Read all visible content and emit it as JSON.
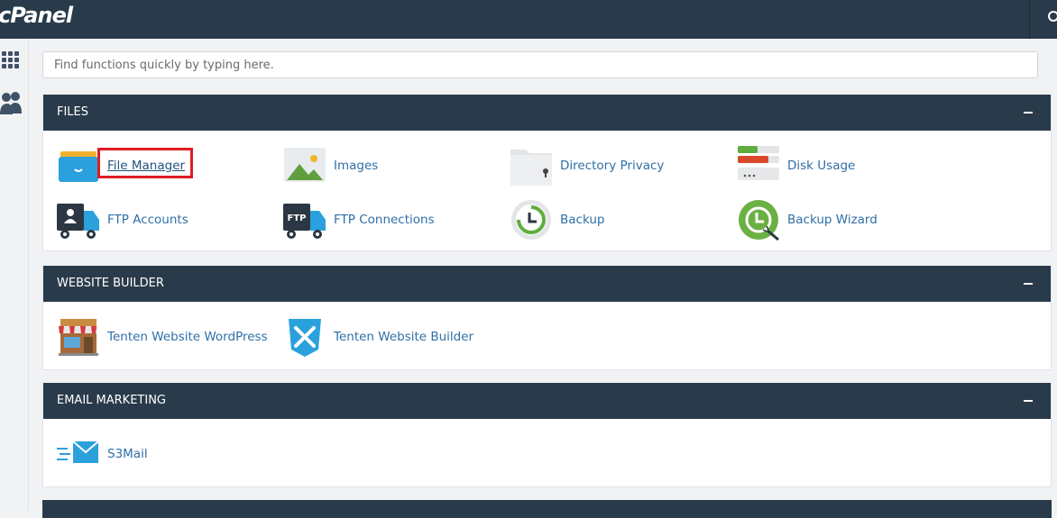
{
  "header": {
    "logo_text": "cPanel"
  },
  "search": {
    "placeholder": "Find functions quickly by typing here."
  },
  "sections": [
    {
      "title": "FILES",
      "items": [
        {
          "label": "File Manager",
          "icon": "file-manager-icon"
        },
        {
          "label": "Images",
          "icon": "images-icon"
        },
        {
          "label": "Directory Privacy",
          "icon": "directory-privacy-icon"
        },
        {
          "label": "Disk Usage",
          "icon": "disk-usage-icon"
        },
        {
          "label": "FTP Accounts",
          "icon": "ftp-accounts-icon"
        },
        {
          "label": "FTP Connections",
          "icon": "ftp-connections-icon"
        },
        {
          "label": "Backup",
          "icon": "backup-icon"
        },
        {
          "label": "Backup Wizard",
          "icon": "backup-wizard-icon"
        }
      ]
    },
    {
      "title": "WEBSITE BUILDER",
      "items": [
        {
          "label": "Tenten Website WordPress",
          "icon": "storefront-icon"
        },
        {
          "label": "Tenten Website Builder",
          "icon": "tools-shield-icon"
        }
      ]
    },
    {
      "title": "EMAIL MARKETING",
      "items": [
        {
          "label": "S3Mail",
          "icon": "mail-icon"
        }
      ]
    }
  ],
  "colors": {
    "header": "#293a4a",
    "link": "#2f6fa6",
    "highlight": "#e01b22"
  }
}
